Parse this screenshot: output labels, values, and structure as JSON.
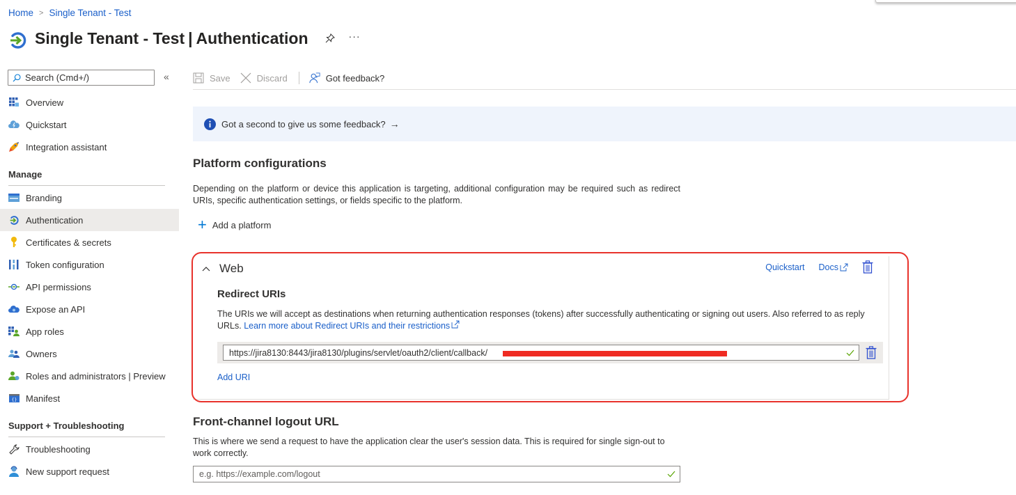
{
  "breadcrumb": [
    {
      "label": "Home"
    },
    {
      "label": "Single Tenant - Test"
    }
  ],
  "header": {
    "app_name": "Single Tenant - Test",
    "separator": "|",
    "page": "Authentication",
    "more": "···"
  },
  "sidebar": {
    "search_placeholder": "Search (Cmd+/)",
    "collapse": "«",
    "top_items": [
      {
        "label": "Overview",
        "icon": "overview-grid-icon"
      },
      {
        "label": "Quickstart",
        "icon": "quickstart-cloud-icon"
      },
      {
        "label": "Integration assistant",
        "icon": "rocket-icon"
      }
    ],
    "sections": [
      {
        "title": "Manage"
      },
      {
        "title": "Support + Troubleshooting"
      }
    ],
    "manage_items": [
      {
        "label": "Branding",
        "icon": "branding-icon"
      },
      {
        "label": "Authentication",
        "icon": "authentication-icon",
        "active": true
      },
      {
        "label": "Certificates & secrets",
        "icon": "key-icon"
      },
      {
        "label": "Token configuration",
        "icon": "token-bars-icon"
      },
      {
        "label": "API permissions",
        "icon": "api-permissions-icon"
      },
      {
        "label": "Expose an API",
        "icon": "cloud-api-icon"
      },
      {
        "label": "App roles",
        "icon": "app-roles-icon"
      },
      {
        "label": "Owners",
        "icon": "owners-icon"
      },
      {
        "label": "Roles and administrators | Preview",
        "icon": "roles-admin-icon"
      },
      {
        "label": "Manifest",
        "icon": "manifest-icon"
      }
    ],
    "support_items": [
      {
        "label": "Troubleshooting",
        "icon": "wrench-icon"
      },
      {
        "label": "New support request",
        "icon": "support-person-icon"
      }
    ]
  },
  "toolbar": {
    "save": "Save",
    "discard": "Discard",
    "feedback": "Got feedback?"
  },
  "banner": {
    "text": "Got a second to give us some feedback?",
    "arrow": "→"
  },
  "platform": {
    "title": "Platform configurations",
    "description": "Depending on the platform or device this application is targeting, additional configuration may be required such as redirect URIs, specific authentication settings, or fields specific to the platform.",
    "add_label": "Add a platform",
    "add_symbol": "+"
  },
  "web": {
    "title": "Web",
    "chevron": "^",
    "quickstart": "Quickstart",
    "docs": "Docs",
    "redirect_title": "Redirect URIs",
    "redirect_desc": "The URIs we will accept as destinations when returning authentication responses (tokens) after successfully authenticating or signing out users. Also referred to as reply URLs. ",
    "learn_more": "Learn more about Redirect URIs and their restrictions",
    "uris": [
      {
        "value": "https://jira8130:8443/jira8130/plugins/servlet/oauth2/client/callback/",
        "redacted": true,
        "valid": true
      }
    ],
    "add_uri": "Add URI"
  },
  "logout": {
    "title": "Front-channel logout URL",
    "description": "This is where we send a request to have the application clear the user's session data. This is required for single sign-out to work correctly.",
    "placeholder": "e.g. https://example.com/logout",
    "value": ""
  },
  "colors": {
    "link": "#1a5fc9",
    "accent": "#0078d4",
    "highlight": "#e8322b",
    "active_nav": "#edebe9",
    "banner_bg": "#eff4fc",
    "valid": "#57a300"
  }
}
